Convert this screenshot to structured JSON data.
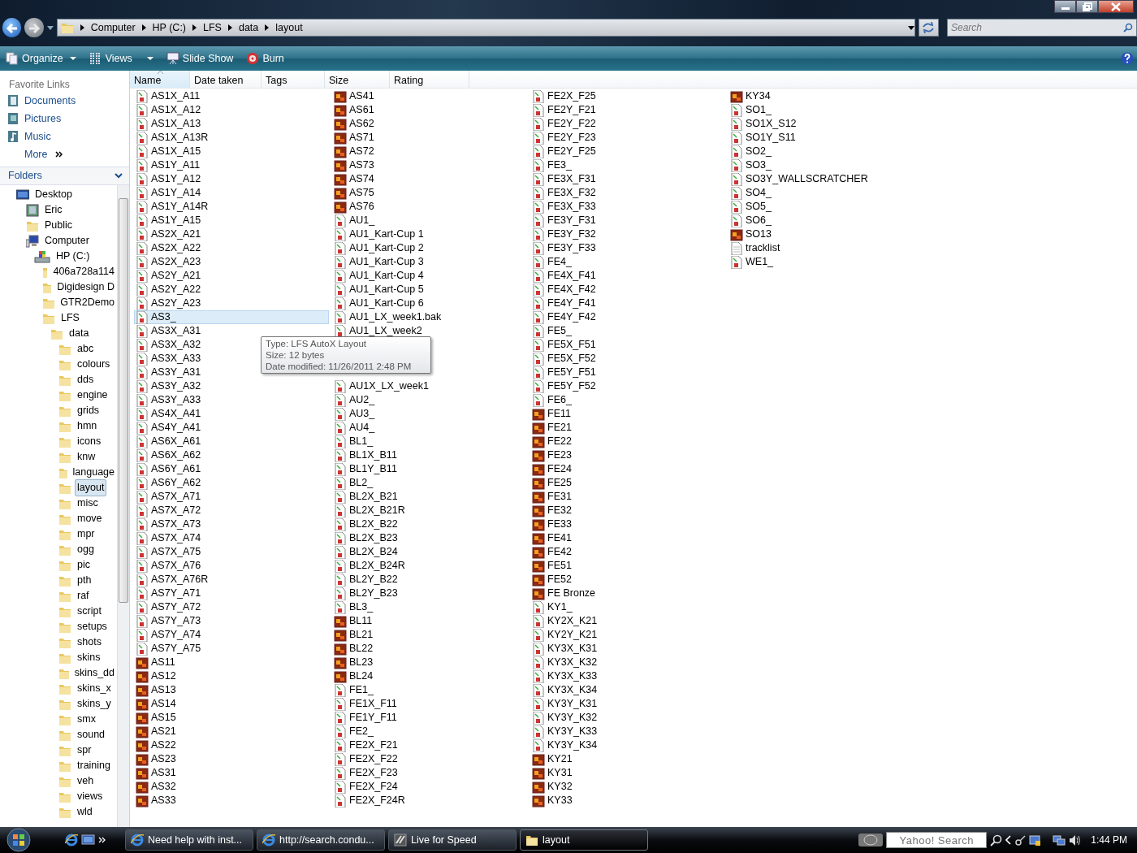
{
  "address": {
    "crumbs": [
      "Computer",
      "HP (C:)",
      "LFS",
      "data",
      "layout"
    ]
  },
  "search": {
    "placeholder": "Search"
  },
  "toolbar": [
    "Organize",
    "Views",
    "Slide Show",
    "Burn"
  ],
  "favorite_links": {
    "title": "Favorite Links",
    "items": [
      {
        "label": "Documents",
        "kind": "documents"
      },
      {
        "label": "Pictures",
        "kind": "pictures"
      },
      {
        "label": "Music",
        "kind": "music"
      },
      {
        "label": "More",
        "kind": "more"
      }
    ]
  },
  "folders": {
    "title": "Folders",
    "tree": [
      {
        "label": "Desktop",
        "kind": "desktop",
        "selected": false,
        "children": [
          {
            "label": "Eric",
            "kind": "user",
            "selected": false
          },
          {
            "label": "Public",
            "kind": "folder",
            "selected": false
          },
          {
            "label": "Computer",
            "kind": "computer",
            "selected": false,
            "children": [
              {
                "label": "HP (C:)",
                "kind": "drive",
                "selected": false,
                "children": [
                  {
                    "label": "406a728a114",
                    "kind": "folder",
                    "selected": false
                  },
                  {
                    "label": "Digidesign D",
                    "kind": "folder",
                    "selected": false
                  },
                  {
                    "label": "GTR2Demo",
                    "kind": "folder",
                    "selected": false
                  },
                  {
                    "label": "LFS",
                    "kind": "folder",
                    "selected": false,
                    "children": [
                      {
                        "label": "data",
                        "kind": "folder",
                        "selected": false,
                        "children": [
                          {
                            "label": "abc",
                            "kind": "folder",
                            "selected": false
                          },
                          {
                            "label": "colours",
                            "kind": "folder",
                            "selected": false
                          },
                          {
                            "label": "dds",
                            "kind": "folder",
                            "selected": false
                          },
                          {
                            "label": "engine",
                            "kind": "folder",
                            "selected": false
                          },
                          {
                            "label": "grids",
                            "kind": "folder",
                            "selected": false
                          },
                          {
                            "label": "hmn",
                            "kind": "folder",
                            "selected": false
                          },
                          {
                            "label": "icons",
                            "kind": "folder",
                            "selected": false
                          },
                          {
                            "label": "knw",
                            "kind": "folder",
                            "selected": false
                          },
                          {
                            "label": "language",
                            "kind": "folder",
                            "selected": false
                          },
                          {
                            "label": "layout",
                            "kind": "folder",
                            "selected": true
                          },
                          {
                            "label": "misc",
                            "kind": "folder",
                            "selected": false
                          },
                          {
                            "label": "move",
                            "kind": "folder",
                            "selected": false
                          },
                          {
                            "label": "mpr",
                            "kind": "folder",
                            "selected": false
                          },
                          {
                            "label": "ogg",
                            "kind": "folder",
                            "selected": false
                          },
                          {
                            "label": "pic",
                            "kind": "folder",
                            "selected": false
                          },
                          {
                            "label": "pth",
                            "kind": "folder",
                            "selected": false
                          },
                          {
                            "label": "raf",
                            "kind": "folder",
                            "selected": false
                          },
                          {
                            "label": "script",
                            "kind": "folder",
                            "selected": false
                          },
                          {
                            "label": "setups",
                            "kind": "folder",
                            "selected": false
                          },
                          {
                            "label": "shots",
                            "kind": "folder",
                            "selected": false
                          },
                          {
                            "label": "skins",
                            "kind": "folder",
                            "selected": false
                          },
                          {
                            "label": "skins_dd",
                            "kind": "folder",
                            "selected": false
                          },
                          {
                            "label": "skins_x",
                            "kind": "folder",
                            "selected": false
                          },
                          {
                            "label": "skins_y",
                            "kind": "folder",
                            "selected": false
                          },
                          {
                            "label": "smx",
                            "kind": "folder",
                            "selected": false
                          },
                          {
                            "label": "sound",
                            "kind": "folder",
                            "selected": false
                          },
                          {
                            "label": "spr",
                            "kind": "folder",
                            "selected": false
                          },
                          {
                            "label": "training",
                            "kind": "folder",
                            "selected": false
                          },
                          {
                            "label": "veh",
                            "kind": "folder",
                            "selected": false
                          },
                          {
                            "label": "views",
                            "kind": "folder",
                            "selected": false
                          },
                          {
                            "label": "wld",
                            "kind": "folder",
                            "selected": false
                          }
                        ]
                      }
                    ]
                  }
                ]
              }
            ]
          }
        ]
      }
    ]
  },
  "columns": [
    {
      "label": "Name",
      "sorted": true
    },
    {
      "label": "Date taken",
      "sorted": false
    },
    {
      "label": "Tags",
      "sorted": false
    },
    {
      "label": "Size",
      "sorted": false
    },
    {
      "label": "Rating",
      "sorted": false
    }
  ],
  "files": [
    {
      "name": "AS1X_A11",
      "kind": "layout",
      "hot": false
    },
    {
      "name": "AS1X_A12",
      "kind": "layout",
      "hot": false
    },
    {
      "name": "AS1X_A13",
      "kind": "layout",
      "hot": false
    },
    {
      "name": "AS1X_A13R",
      "kind": "layout",
      "hot": false
    },
    {
      "name": "AS1X_A15",
      "kind": "layout",
      "hot": false
    },
    {
      "name": "AS1Y_A11",
      "kind": "layout",
      "hot": false
    },
    {
      "name": "AS1Y_A12",
      "kind": "layout",
      "hot": false
    },
    {
      "name": "AS1Y_A14",
      "kind": "layout",
      "hot": false
    },
    {
      "name": "AS1Y_A14R",
      "kind": "layout",
      "hot": false
    },
    {
      "name": "AS1Y_A15",
      "kind": "layout",
      "hot": false
    },
    {
      "name": "AS2X_A21",
      "kind": "layout",
      "hot": false
    },
    {
      "name": "AS2X_A22",
      "kind": "layout",
      "hot": false
    },
    {
      "name": "AS2X_A23",
      "kind": "layout",
      "hot": false
    },
    {
      "name": "AS2Y_A21",
      "kind": "layout",
      "hot": false
    },
    {
      "name": "AS2Y_A22",
      "kind": "layout",
      "hot": false
    },
    {
      "name": "AS2Y_A23",
      "kind": "layout",
      "hot": false
    },
    {
      "name": "AS3_",
      "kind": "layout",
      "hot": true
    },
    {
      "name": "AS3X_A31",
      "kind": "layout",
      "hot": false
    },
    {
      "name": "AS3X_A32",
      "kind": "layout",
      "hot": false
    },
    {
      "name": "AS3X_A33",
      "kind": "layout",
      "hot": false
    },
    {
      "name": "AS3Y_A31",
      "kind": "layout",
      "hot": false
    },
    {
      "name": "AS3Y_A32",
      "kind": "layout",
      "hot": false
    },
    {
      "name": "AS3Y_A33",
      "kind": "layout",
      "hot": false
    },
    {
      "name": "AS4X_A41",
      "kind": "layout",
      "hot": false
    },
    {
      "name": "AS4Y_A41",
      "kind": "layout",
      "hot": false
    },
    {
      "name": "AS6X_A61",
      "kind": "layout",
      "hot": false
    },
    {
      "name": "AS6X_A62",
      "kind": "layout",
      "hot": false
    },
    {
      "name": "AS6Y_A61",
      "kind": "layout",
      "hot": false
    },
    {
      "name": "AS6Y_A62",
      "kind": "layout",
      "hot": false
    },
    {
      "name": "AS7X_A71",
      "kind": "layout",
      "hot": false
    },
    {
      "name": "AS7X_A72",
      "kind": "layout",
      "hot": false
    },
    {
      "name": "AS7X_A73",
      "kind": "layout",
      "hot": false
    },
    {
      "name": "AS7X_A74",
      "kind": "layout",
      "hot": false
    },
    {
      "name": "AS7X_A75",
      "kind": "layout",
      "hot": false
    },
    {
      "name": "AS7X_A76",
      "kind": "layout",
      "hot": false
    },
    {
      "name": "AS7X_A76R",
      "kind": "layout",
      "hot": false
    },
    {
      "name": "AS7Y_A71",
      "kind": "layout",
      "hot": false
    },
    {
      "name": "AS7Y_A72",
      "kind": "layout",
      "hot": false
    },
    {
      "name": "AS7Y_A73",
      "kind": "layout",
      "hot": false
    },
    {
      "name": "AS7Y_A74",
      "kind": "layout",
      "hot": false
    },
    {
      "name": "AS7Y_A75",
      "kind": "layout",
      "hot": false
    },
    {
      "name": "AS11",
      "kind": "replay",
      "hot": false
    },
    {
      "name": "AS12",
      "kind": "replay",
      "hot": false
    },
    {
      "name": "AS13",
      "kind": "replay",
      "hot": false
    },
    {
      "name": "AS14",
      "kind": "replay",
      "hot": false
    },
    {
      "name": "AS15",
      "kind": "replay",
      "hot": false
    },
    {
      "name": "AS21",
      "kind": "replay",
      "hot": false
    },
    {
      "name": "AS22",
      "kind": "replay",
      "hot": false
    },
    {
      "name": "AS23",
      "kind": "replay",
      "hot": false
    },
    {
      "name": "AS31",
      "kind": "replay",
      "hot": false
    },
    {
      "name": "AS32",
      "kind": "replay",
      "hot": false
    },
    {
      "name": "AS33",
      "kind": "replay",
      "hot": false
    },
    {
      "name": "AS41",
      "kind": "replay",
      "hot": false
    },
    {
      "name": "AS61",
      "kind": "replay",
      "hot": false
    },
    {
      "name": "AS62",
      "kind": "replay",
      "hot": false
    },
    {
      "name": "AS71",
      "kind": "replay",
      "hot": false
    },
    {
      "name": "AS72",
      "kind": "replay",
      "hot": false
    },
    {
      "name": "AS73",
      "kind": "replay",
      "hot": false
    },
    {
      "name": "AS74",
      "kind": "replay",
      "hot": false
    },
    {
      "name": "AS75",
      "kind": "replay",
      "hot": false
    },
    {
      "name": "AS76",
      "kind": "replay",
      "hot": false
    },
    {
      "name": "AU1_",
      "kind": "layout",
      "hot": false
    },
    {
      "name": "AU1_Kart-Cup 1",
      "kind": "layout",
      "hot": false
    },
    {
      "name": "AU1_Kart-Cup 2",
      "kind": "layout",
      "hot": false
    },
    {
      "name": "AU1_Kart-Cup 3",
      "kind": "layout",
      "hot": false
    },
    {
      "name": "AU1_Kart-Cup 4",
      "kind": "layout",
      "hot": false
    },
    {
      "name": "AU1_Kart-Cup 5",
      "kind": "layout",
      "hot": false
    },
    {
      "name": "AU1_Kart-Cup 6",
      "kind": "layout",
      "hot": false
    },
    {
      "name": "AU1_LX_week1.bak",
      "kind": "layout",
      "hot": false
    },
    {
      "name": "AU1_LX_week2",
      "kind": "layout",
      "hot": false
    },
    {
      "kind": "covered"
    },
    {
      "kind": "covered"
    },
    {
      "kind": "covered"
    },
    {
      "name": "AU1X_LX_week1",
      "kind": "layout",
      "hot": false
    },
    {
      "name": "AU2_",
      "kind": "layout",
      "hot": false
    },
    {
      "name": "AU3_",
      "kind": "layout",
      "hot": false
    },
    {
      "name": "AU4_",
      "kind": "layout",
      "hot": false
    },
    {
      "name": "BL1_",
      "kind": "layout",
      "hot": false
    },
    {
      "name": "BL1X_B11",
      "kind": "layout",
      "hot": false
    },
    {
      "name": "BL1Y_B11",
      "kind": "layout",
      "hot": false
    },
    {
      "name": "BL2_",
      "kind": "layout",
      "hot": false
    },
    {
      "name": "BL2X_B21",
      "kind": "layout",
      "hot": false
    },
    {
      "name": "BL2X_B21R",
      "kind": "layout",
      "hot": false
    },
    {
      "name": "BL2X_B22",
      "kind": "layout",
      "hot": false
    },
    {
      "name": "BL2X_B23",
      "kind": "layout",
      "hot": false
    },
    {
      "name": "BL2X_B24",
      "kind": "layout",
      "hot": false
    },
    {
      "name": "BL2X_B24R",
      "kind": "layout",
      "hot": false
    },
    {
      "name": "BL2Y_B22",
      "kind": "layout",
      "hot": false
    },
    {
      "name": "BL2Y_B23",
      "kind": "layout",
      "hot": false
    },
    {
      "name": "BL3_",
      "kind": "layout",
      "hot": false
    },
    {
      "name": "BL11",
      "kind": "replay",
      "hot": false
    },
    {
      "name": "BL21",
      "kind": "replay",
      "hot": false
    },
    {
      "name": "BL22",
      "kind": "replay",
      "hot": false
    },
    {
      "name": "BL23",
      "kind": "replay",
      "hot": false
    },
    {
      "name": "BL24",
      "kind": "replay",
      "hot": false
    },
    {
      "name": "FE1_",
      "kind": "layout",
      "hot": false
    },
    {
      "name": "FE1X_F11",
      "kind": "layout",
      "hot": false
    },
    {
      "name": "FE1Y_F11",
      "kind": "layout",
      "hot": false
    },
    {
      "name": "FE2_",
      "kind": "layout",
      "hot": false
    },
    {
      "name": "FE2X_F21",
      "kind": "layout",
      "hot": false
    },
    {
      "name": "FE2X_F22",
      "kind": "layout",
      "hot": false
    },
    {
      "name": "FE2X_F23",
      "kind": "layout",
      "hot": false
    },
    {
      "name": "FE2X_F24",
      "kind": "layout",
      "hot": false
    },
    {
      "name": "FE2X_F24R",
      "kind": "layout",
      "hot": false
    },
    {
      "name": "FE2X_F25",
      "kind": "layout",
      "hot": false
    },
    {
      "name": "FE2Y_F21",
      "kind": "layout",
      "hot": false
    },
    {
      "name": "FE2Y_F22",
      "kind": "layout",
      "hot": false
    },
    {
      "name": "FE2Y_F23",
      "kind": "layout",
      "hot": false
    },
    {
      "name": "FE2Y_F25",
      "kind": "layout",
      "hot": false
    },
    {
      "name": "FE3_",
      "kind": "layout",
      "hot": false
    },
    {
      "name": "FE3X_F31",
      "kind": "layout",
      "hot": false
    },
    {
      "name": "FE3X_F32",
      "kind": "layout",
      "hot": false
    },
    {
      "name": "FE3X_F33",
      "kind": "layout",
      "hot": false
    },
    {
      "name": "FE3Y_F31",
      "kind": "layout",
      "hot": false
    },
    {
      "name": "FE3Y_F32",
      "kind": "layout",
      "hot": false
    },
    {
      "name": "FE3Y_F33",
      "kind": "layout",
      "hot": false
    },
    {
      "name": "FE4_",
      "kind": "layout",
      "hot": false
    },
    {
      "name": "FE4X_F41",
      "kind": "layout",
      "hot": false
    },
    {
      "name": "FE4X_F42",
      "kind": "layout",
      "hot": false
    },
    {
      "name": "FE4Y_F41",
      "kind": "layout",
      "hot": false
    },
    {
      "name": "FE4Y_F42",
      "kind": "layout",
      "hot": false
    },
    {
      "name": "FE5_",
      "kind": "layout",
      "hot": false
    },
    {
      "name": "FE5X_F51",
      "kind": "layout",
      "hot": false
    },
    {
      "name": "FE5X_F52",
      "kind": "layout",
      "hot": false
    },
    {
      "name": "FE5Y_F51",
      "kind": "layout",
      "hot": false
    },
    {
      "name": "FE5Y_F52",
      "kind": "layout",
      "hot": false
    },
    {
      "name": "FE6_",
      "kind": "layout",
      "hot": false
    },
    {
      "name": "FE11",
      "kind": "replay",
      "hot": false
    },
    {
      "name": "FE21",
      "kind": "replay",
      "hot": false
    },
    {
      "name": "FE22",
      "kind": "replay",
      "hot": false
    },
    {
      "name": "FE23",
      "kind": "replay",
      "hot": false
    },
    {
      "name": "FE24",
      "kind": "replay",
      "hot": false
    },
    {
      "name": "FE25",
      "kind": "replay",
      "hot": false
    },
    {
      "name": "FE31",
      "kind": "replay",
      "hot": false
    },
    {
      "name": "FE32",
      "kind": "replay",
      "hot": false
    },
    {
      "name": "FE33",
      "kind": "replay",
      "hot": false
    },
    {
      "name": "FE41",
      "kind": "replay",
      "hot": false
    },
    {
      "name": "FE42",
      "kind": "replay",
      "hot": false
    },
    {
      "name": "FE51",
      "kind": "replay",
      "hot": false
    },
    {
      "name": "FE52",
      "kind": "replay",
      "hot": false
    },
    {
      "name": "FE Bronze",
      "kind": "replay",
      "hot": false
    },
    {
      "name": "KY1_",
      "kind": "layout",
      "hot": false
    },
    {
      "name": "KY2X_K21",
      "kind": "layout",
      "hot": false
    },
    {
      "name": "KY2Y_K21",
      "kind": "layout",
      "hot": false
    },
    {
      "name": "KY3X_K31",
      "kind": "layout",
      "hot": false
    },
    {
      "name": "KY3X_K32",
      "kind": "layout",
      "hot": false
    },
    {
      "name": "KY3X_K33",
      "kind": "layout",
      "hot": false
    },
    {
      "name": "KY3X_K34",
      "kind": "layout",
      "hot": false
    },
    {
      "name": "KY3Y_K31",
      "kind": "layout",
      "hot": false
    },
    {
      "name": "KY3Y_K32",
      "kind": "layout",
      "hot": false
    },
    {
      "name": "KY3Y_K33",
      "kind": "layout",
      "hot": false
    },
    {
      "name": "KY3Y_K34",
      "kind": "layout",
      "hot": false
    },
    {
      "name": "KY21",
      "kind": "replay",
      "hot": false
    },
    {
      "name": "KY31",
      "kind": "replay",
      "hot": false
    },
    {
      "name": "KY32",
      "kind": "replay",
      "hot": false
    },
    {
      "name": "KY33",
      "kind": "replay",
      "hot": false
    },
    {
      "name": "KY34",
      "kind": "replay",
      "hot": false
    },
    {
      "name": "SO1_",
      "kind": "layout",
      "hot": false
    },
    {
      "name": "SO1X_S12",
      "kind": "layout",
      "hot": false
    },
    {
      "name": "SO1Y_S11",
      "kind": "layout",
      "hot": false
    },
    {
      "name": "SO2_",
      "kind": "layout",
      "hot": false
    },
    {
      "name": "SO3_",
      "kind": "layout",
      "hot": false
    },
    {
      "name": "SO3Y_WALLSCRATCHER",
      "kind": "layout",
      "hot": false
    },
    {
      "name": "SO4_",
      "kind": "layout",
      "hot": false
    },
    {
      "name": "SO5_",
      "kind": "layout",
      "hot": false
    },
    {
      "name": "SO6_",
      "kind": "layout",
      "hot": false
    },
    {
      "name": "SO13",
      "kind": "replay",
      "hot": false
    },
    {
      "name": "tracklist",
      "kind": "text",
      "hot": false
    },
    {
      "name": "WE1_",
      "kind": "layout",
      "hot": false
    }
  ],
  "tooltip": [
    "Type: LFS AutoX Layout",
    "Size: 12 bytes",
    "Date modified: 11/26/2011 2:48 PM"
  ],
  "taskbar": {
    "tasks": [
      {
        "label": "Need help with inst...",
        "kind": "browser",
        "selected": false
      },
      {
        "label": "http://search.condu...",
        "kind": "browser",
        "selected": false
      },
      {
        "label": "Live for Speed",
        "kind": "game",
        "selected": false
      },
      {
        "label": "layout",
        "kind": "folder",
        "selected": true
      }
    ],
    "search_placeholder": "Yahoo! Search",
    "clock": "1:44 PM"
  }
}
